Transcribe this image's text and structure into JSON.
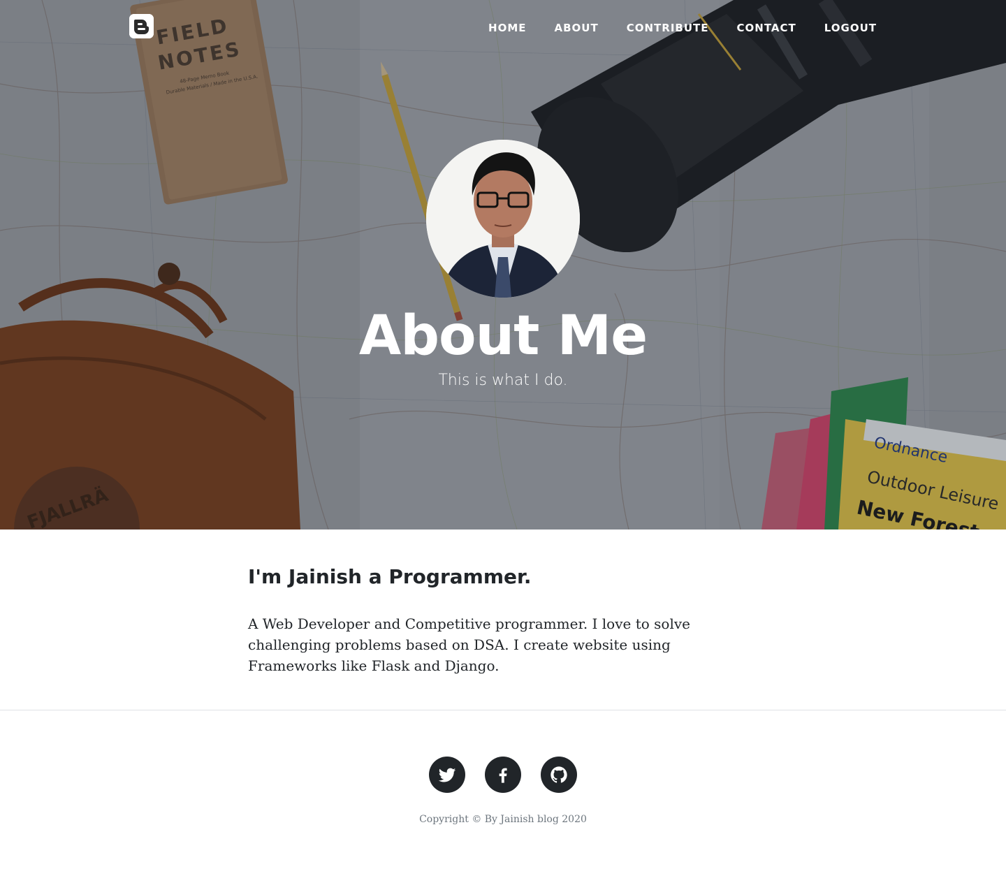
{
  "nav": {
    "brand_icon": "blogger-icon",
    "links": [
      {
        "label": "HOME"
      },
      {
        "label": "ABOUT"
      },
      {
        "label": "CONTRIBUTE"
      },
      {
        "label": "CONTACT"
      },
      {
        "label": "LOGOUT"
      }
    ]
  },
  "hero": {
    "title": "About Me",
    "subtitle": "This is what I do.",
    "avatar_icon": "profile-photo"
  },
  "main": {
    "heading": "I'm Jainish a Programmer.",
    "body": "A Web Developer and Competitive programmer. I love to solve challenging problems based on DSA. I create website using Frameworks like Flask and Django."
  },
  "footer": {
    "social": [
      {
        "icon": "twitter-icon"
      },
      {
        "icon": "facebook-icon"
      },
      {
        "icon": "github-icon"
      }
    ],
    "copyright": "Copyright © By Jainish blog 2020"
  },
  "colors": {
    "text_dark": "#212529",
    "muted": "#6c757d",
    "divider": "#dee2e6",
    "nav_text": "#ffffff"
  }
}
